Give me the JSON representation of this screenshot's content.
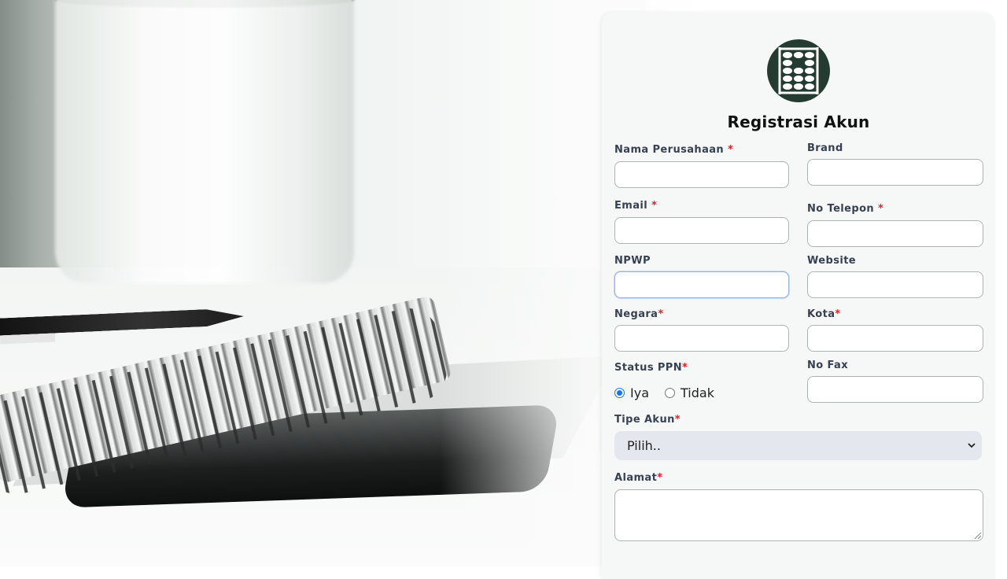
{
  "form": {
    "title": "Registrasi Akun",
    "required_mark": "*",
    "fields": {
      "nama_perusahaan": {
        "label": "Nama Perusahaan",
        "value": ""
      },
      "brand": {
        "label": "Brand",
        "value": ""
      },
      "email": {
        "label": "Email",
        "value": ""
      },
      "no_telepon": {
        "label": "No Telepon",
        "value": ""
      },
      "npwp": {
        "label": "NPWP",
        "value": ""
      },
      "website": {
        "label": "Website",
        "value": ""
      },
      "negara": {
        "label": "Negara",
        "value": ""
      },
      "kota": {
        "label": "Kota",
        "value": ""
      },
      "status_ppn": {
        "label": "Status PPN",
        "options": [
          "Iya",
          "Tidak"
        ],
        "selected": "Iya"
      },
      "no_fax": {
        "label": "No Fax",
        "value": ""
      },
      "tipe_akun": {
        "label": "Tipe Akun",
        "selected": "Pilih.."
      },
      "alamat": {
        "label": "Alamat",
        "value": ""
      }
    }
  },
  "colors": {
    "accent": "#1a73e8",
    "required": "#dc2626",
    "logo_bg": "#243b32",
    "card_bg": "#f5f8f7"
  },
  "icons": {
    "logo": "abacus-icon",
    "select_chevron": "chevron-down-icon"
  }
}
